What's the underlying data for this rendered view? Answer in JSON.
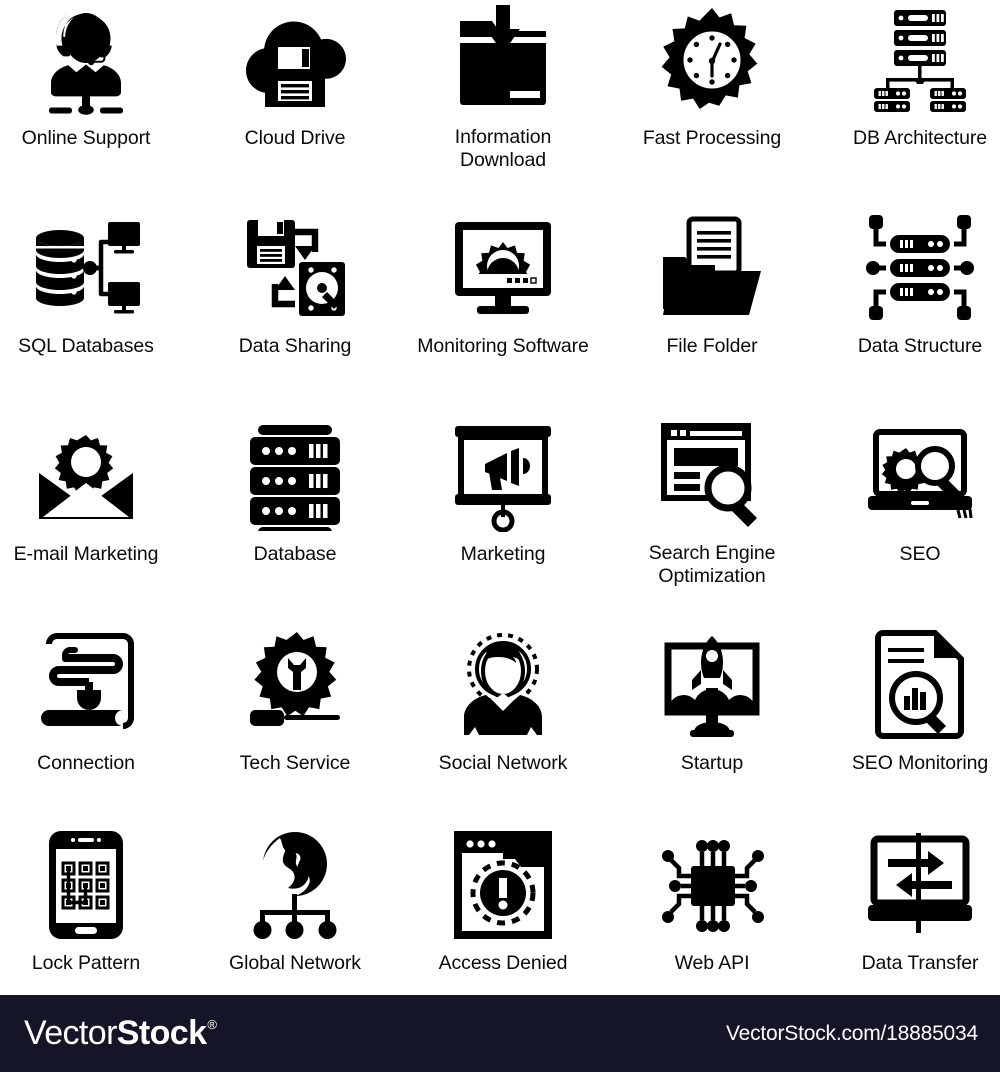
{
  "page": {
    "background_color": "#ffffff",
    "icon_color": "#000000",
    "label_color": "#0a0a0a",
    "columns": 5,
    "rows": 5
  },
  "icons": [
    {
      "id": "online-support",
      "label": "Online Support",
      "icon": "headset-operator-icon"
    },
    {
      "id": "cloud-drive",
      "label": "Cloud Drive",
      "icon": "cloud-floppy-disk-icon"
    },
    {
      "id": "information-download",
      "label": "Information\nDownload",
      "icon": "folder-download-arrow-icon"
    },
    {
      "id": "fast-processing",
      "label": "Fast Processing",
      "icon": "gear-clock-icon"
    },
    {
      "id": "db-architecture",
      "label": "DB Architecture",
      "icon": "server-rack-network-icon"
    },
    {
      "id": "sql-databases",
      "label": "SQL Databases",
      "icon": "database-monitors-icon"
    },
    {
      "id": "data-sharing",
      "label": "Data Sharing",
      "icon": "floppy-harddisk-arrows-icon"
    },
    {
      "id": "monitoring-software",
      "label": "Monitoring Software",
      "icon": "monitor-gear-icon"
    },
    {
      "id": "file-folder",
      "label": "File Folder",
      "icon": "folder-document-icon"
    },
    {
      "id": "data-structure",
      "label": "Data Structure",
      "icon": "server-nodes-icon"
    },
    {
      "id": "email-marketing",
      "label": "E-mail Marketing",
      "icon": "envelope-gear-icon"
    },
    {
      "id": "database",
      "label": "Database",
      "icon": "server-stack-icon"
    },
    {
      "id": "marketing",
      "label": "Marketing",
      "icon": "presentation-megaphone-icon"
    },
    {
      "id": "search-engine-optimization",
      "label": "Search Engine\nOptimization",
      "icon": "browser-magnifier-icon"
    },
    {
      "id": "seo",
      "label": "SEO",
      "icon": "laptop-gear-magnifier-icon"
    },
    {
      "id": "connection",
      "label": "Connection",
      "icon": "plug-cable-scroll-icon"
    },
    {
      "id": "tech-service",
      "label": "Tech Service",
      "icon": "gear-wrench-screwdriver-icon"
    },
    {
      "id": "social-network",
      "label": "Social Network",
      "icon": "person-network-icon"
    },
    {
      "id": "startup",
      "label": "Startup",
      "icon": "monitor-rocket-icon"
    },
    {
      "id": "seo-monitoring",
      "label": "SEO Monitoring",
      "icon": "document-chart-magnifier-icon"
    },
    {
      "id": "lock-pattern",
      "label": "Lock Pattern",
      "icon": "smartphone-pattern-lock-icon"
    },
    {
      "id": "global-network",
      "label": "Global Network",
      "icon": "globe-network-icon"
    },
    {
      "id": "access-denied",
      "label": "Access Denied",
      "icon": "browser-warning-icon"
    },
    {
      "id": "web-api",
      "label": "Web API",
      "icon": "microchip-icon"
    },
    {
      "id": "data-transfer",
      "label": "Data Transfer",
      "icon": "laptop-transfer-arrows-icon"
    }
  ],
  "footer": {
    "background_color": "#141627",
    "brand_part1": "Vector",
    "brand_part2": "Stock",
    "brand_mark": "®",
    "site_url": "VectorStock.com/18885034"
  }
}
